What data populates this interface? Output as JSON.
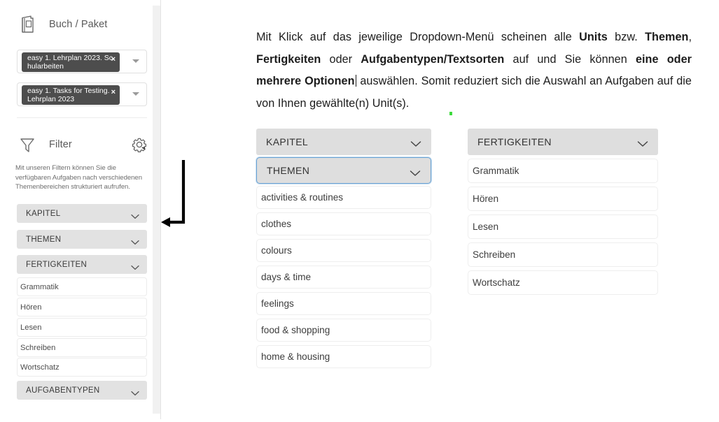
{
  "sidebar": {
    "book_section": {
      "icon": "book-icon",
      "title": "Buch / Paket",
      "chips": [
        {
          "label": "easy 1. Lehrplan 2023. Schularbeiten",
          "remove": "×"
        },
        {
          "label": "easy 1. Tasks for Testing. Lehrplan 2023",
          "remove": "×"
        }
      ]
    },
    "filter_section": {
      "icon": "funnel-icon",
      "title": "Filter",
      "settings_icon": "gear-icon",
      "description": "Mit unseren Filtern können Sie die verfügbaren Aufgaben nach verschiedenen Themenbereichen strukturiert aufrufen.",
      "accordions": [
        {
          "label": "KAPITEL"
        },
        {
          "label": "THEMEN"
        },
        {
          "label": "FERTIGKEITEN"
        }
      ],
      "fertigkeiten_items": [
        "Grammatik",
        "Hören",
        "Lesen",
        "Schreiben",
        "Wortschatz"
      ],
      "last_accordion": {
        "label": "AUFGABENTYPEN"
      }
    }
  },
  "content": {
    "paragraph": {
      "segments": [
        {
          "text": "Mit Klick auf das jeweilige Dropdown-Menü scheinen alle ",
          "bold": false
        },
        {
          "text": "Units",
          "bold": true
        },
        {
          "text": " bzw. ",
          "bold": false
        },
        {
          "text": "Themen",
          "bold": true
        },
        {
          "text": ", ",
          "bold": false
        },
        {
          "text": "Fertigkeiten",
          "bold": true
        },
        {
          "text": " oder ",
          "bold": false
        },
        {
          "text": "Aufgabentypen/Textsorten",
          "bold": true
        },
        {
          "text": " auf und Sie können ",
          "bold": false
        },
        {
          "text": "eine oder mehrere Optionen",
          "bold": true
        },
        {
          "text": " auswählen. Somit reduziert sich die Auswahl an Aufgaben auf die von Ihnen gewählte(n) Unit(s).",
          "bold": false
        }
      ],
      "plain": "Mit Klick auf das jeweilige Dropdown-Menü scheinen alle Units bzw. Themen, Fertigkeiten oder Aufgabentypen/Textsorten auf und Sie können eine oder mehrere Optionen auswählen. Somit reduziert sich die Auswahl an Aufgaben auf die von Ihnen gewählte(n) Unit(s)."
    },
    "annotation_arrow": {
      "icon": "elbow-arrow-left-icon",
      "direction": "left"
    },
    "green_marker": {
      "color": "#3ddb3d"
    },
    "dropdowns": [
      {
        "id": "themen",
        "collapsed_header": {
          "label": "KAPITEL",
          "state": "collapsed"
        },
        "open_header": {
          "label": "THEMEN",
          "state": "open",
          "focus_color": "#6aa3d4"
        },
        "options": [
          "activities & routines",
          "clothes",
          "colours",
          "days & time",
          "feelings",
          "food & shopping",
          "home & housing"
        ]
      },
      {
        "id": "fertigkeiten",
        "open_header": {
          "label": "FERTIGKEITEN",
          "state": "open"
        },
        "options": [
          "Grammatik",
          "Hören",
          "Lesen",
          "Schreiben",
          "Wortschatz"
        ]
      }
    ]
  },
  "colors": {
    "header_grey": "#dedede",
    "sidebar_accordion_grey": "#e2e2e2",
    "chip_dark": "#4d4d4d",
    "focus_blue": "#6aa3d4",
    "text_dark": "#1c1c1c"
  }
}
